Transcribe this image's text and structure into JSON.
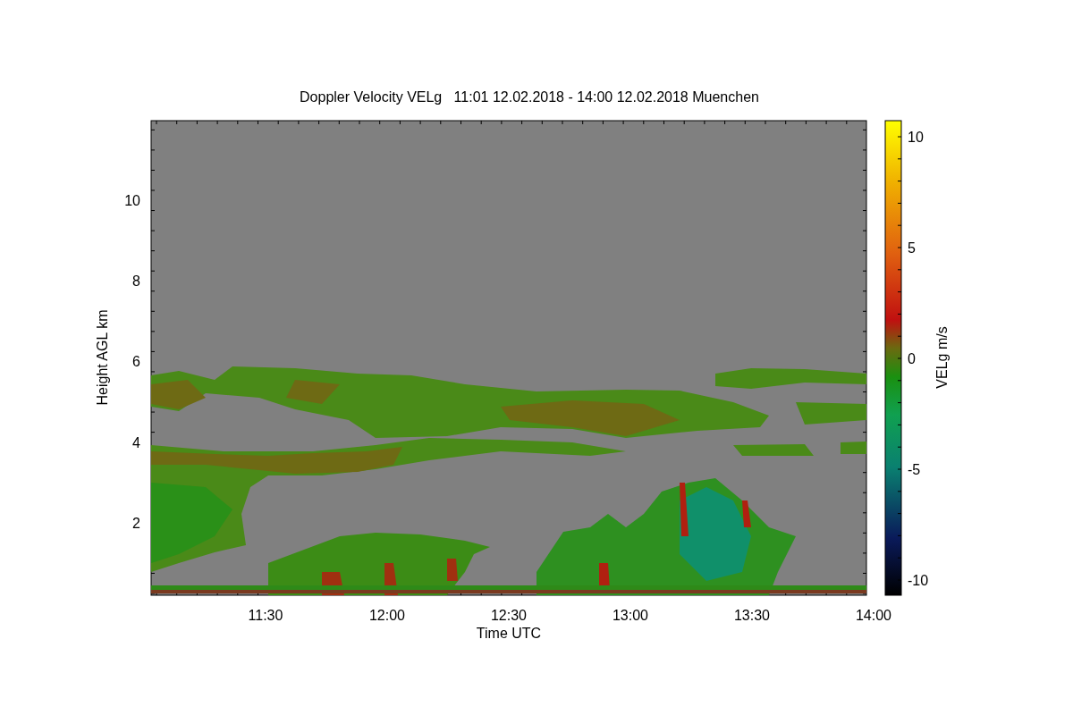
{
  "plot": {
    "title": "Doppler Velocity VELg   11:01 12.02.2018 - 14:00 12.02.2018 Muenchen",
    "xlabel": "Time UTC",
    "ylabel": "Height AGL km",
    "xtick_labels": [
      "11:30",
      "12:00",
      "12:30",
      "13:00",
      "13:30",
      "14:00"
    ],
    "ytick_labels": [
      "10",
      "8",
      "6",
      "4",
      "2"
    ],
    "colorbar": {
      "label": "VELg m/s",
      "tick_labels": [
        "10",
        "5",
        "0",
        "-5",
        "-10"
      ]
    }
  }
}
